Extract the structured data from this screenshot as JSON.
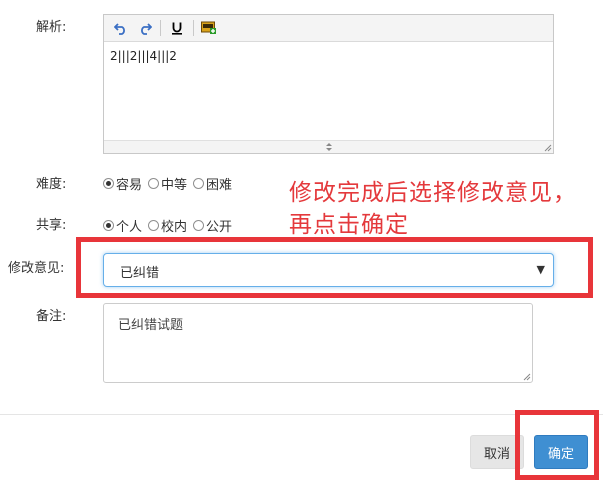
{
  "form": {
    "analysis": {
      "label": "解析:",
      "content": "2|||2|||4|||2"
    },
    "difficulty": {
      "label": "难度:",
      "options": [
        "容易",
        "中等",
        "困难"
      ],
      "selected_index": 0
    },
    "share": {
      "label": "共享:",
      "options": [
        "个人",
        "校内",
        "公开"
      ],
      "selected_index": 0
    },
    "opinion": {
      "label": "修改意见:",
      "selected_value": "已纠错"
    },
    "remark": {
      "label": "备注:",
      "value": "已纠错试题"
    }
  },
  "annotation": {
    "text": "修改完成后选择修改意见，再点击确定",
    "color": "#e4393c"
  },
  "buttons": {
    "cancel": "取消",
    "confirm": "确定"
  },
  "colors": {
    "confirm_button": "#3f8fd2",
    "highlight_frame": "#e8353a",
    "select_focus": "#66afe9"
  }
}
